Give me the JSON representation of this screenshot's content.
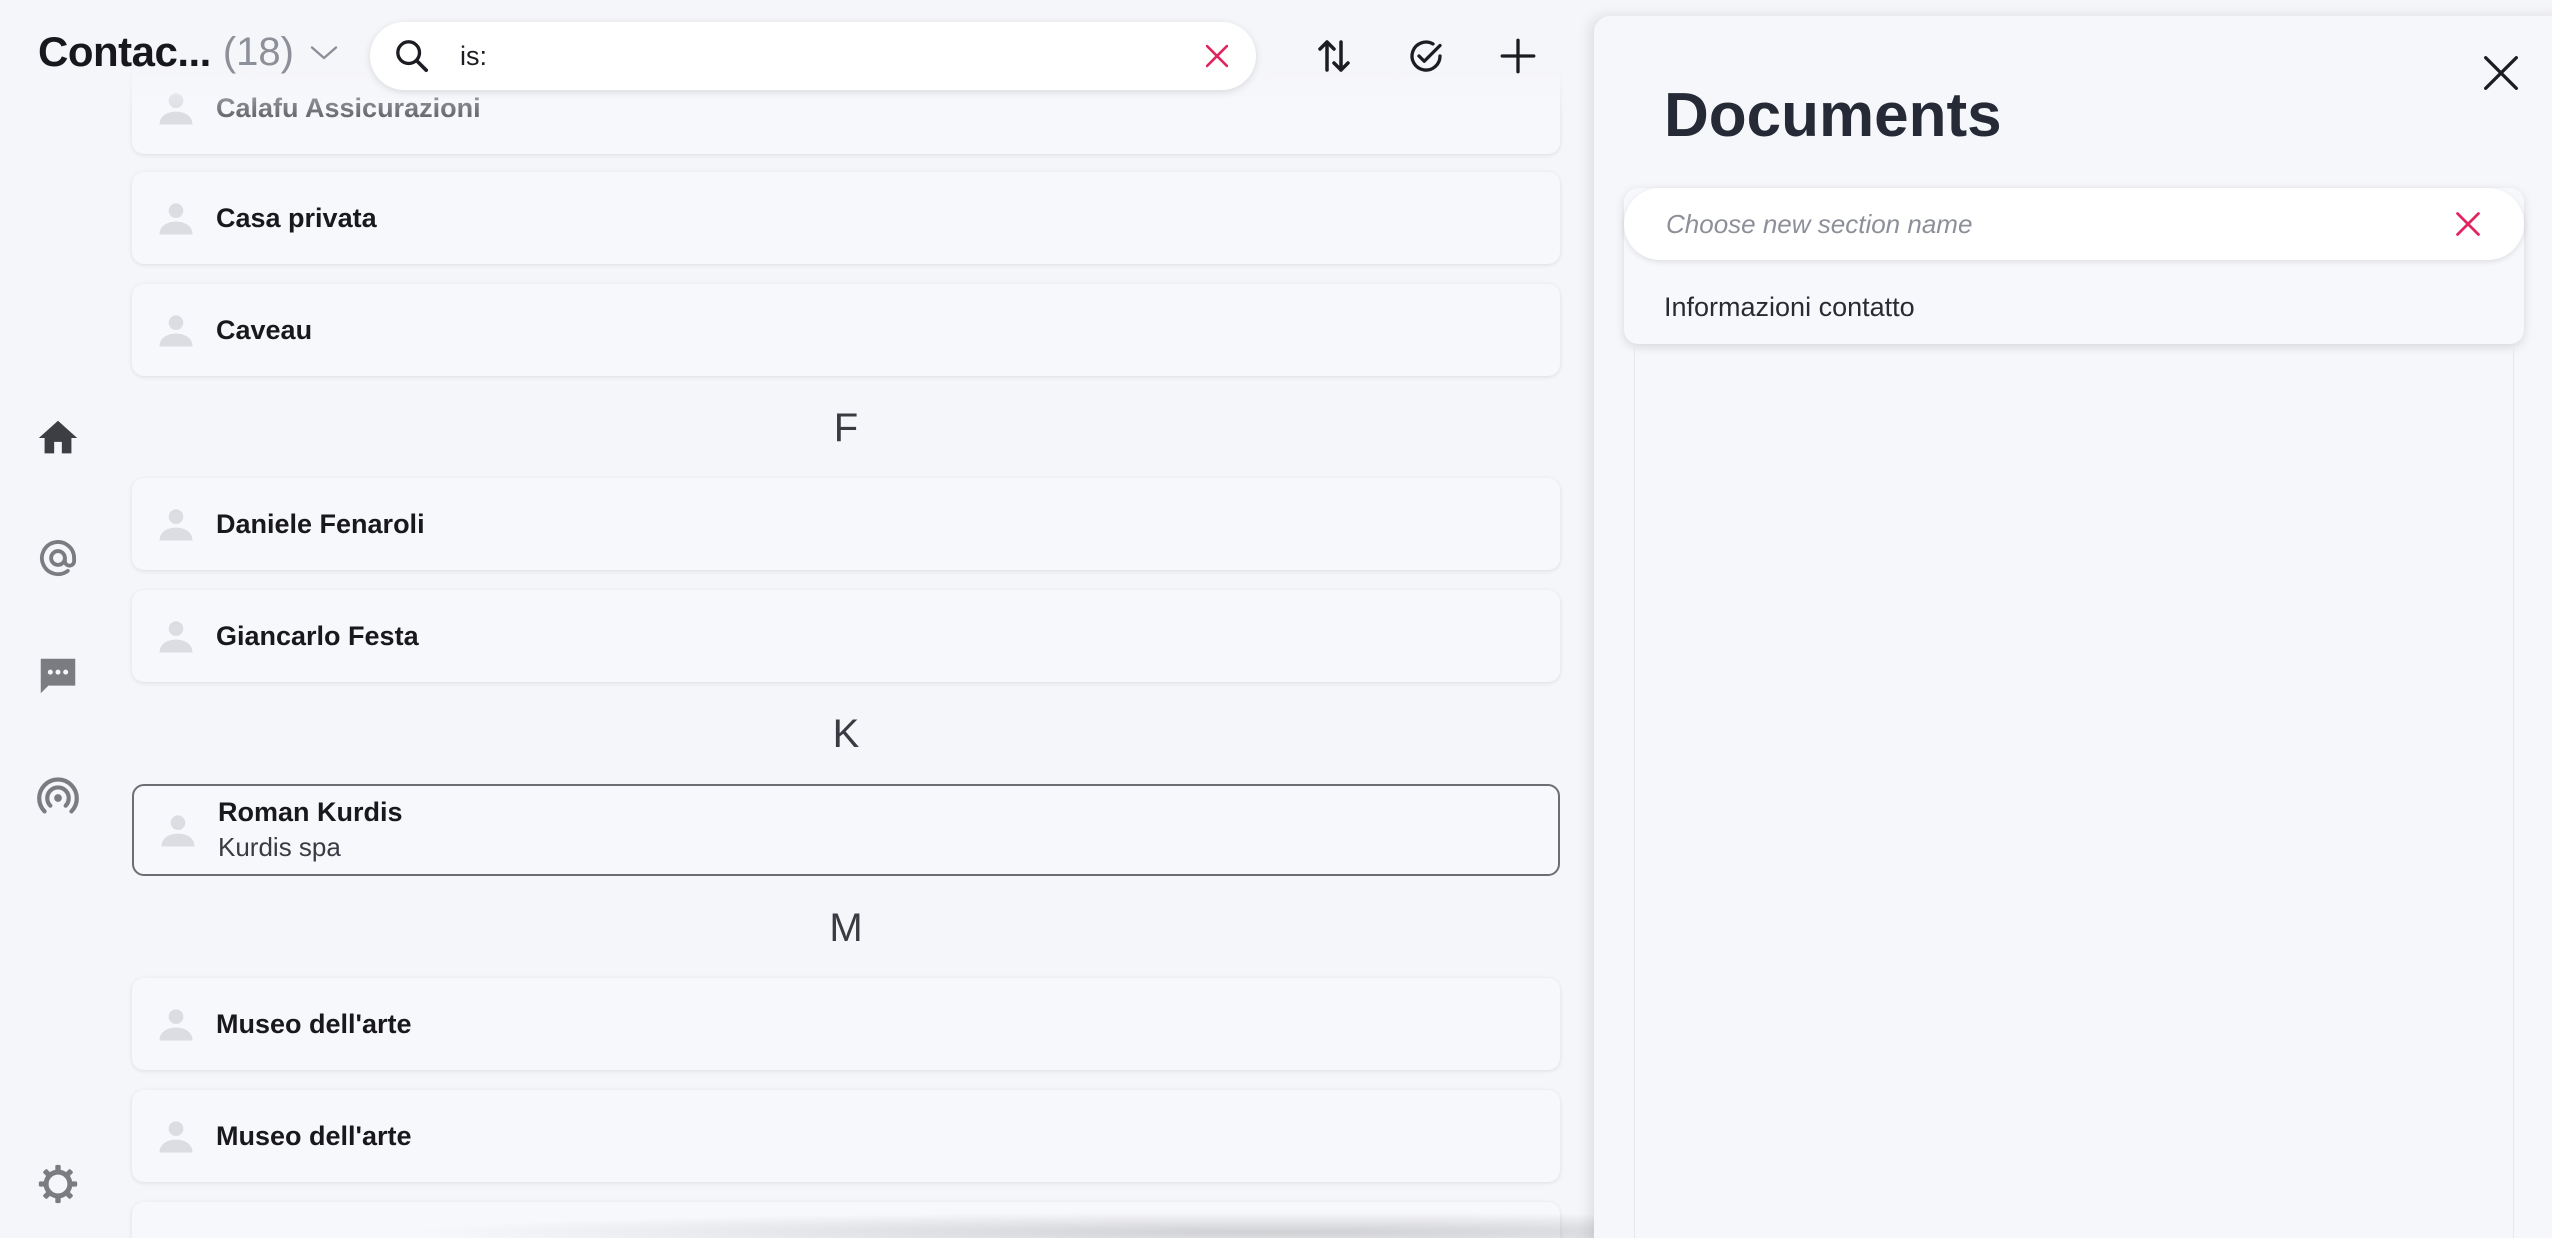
{
  "header": {
    "title": "Contac...",
    "count": "(18)",
    "search_value": "is:"
  },
  "contacts": {
    "partial_top": "Calafu Assicurazioni",
    "casa_privata": "Casa privata",
    "caveau": "Caveau",
    "section_f": "F",
    "daniele": "Daniele Fenaroli",
    "giancarlo": "Giancarlo Festa",
    "section_k": "K",
    "roman": {
      "name": "Roman Kurdis",
      "company": "Kurdis spa"
    },
    "section_m": "M",
    "museo1": "Museo dell'arte",
    "museo2": "Museo dell'arte"
  },
  "panel": {
    "title": "Documents",
    "section_placeholder": "Choose new section name",
    "option": "Informazioni contatto"
  },
  "colors": {
    "accent_red": "#e0245e",
    "icon_dark": "#3d3e44",
    "icon_gray": "#7b7c82"
  }
}
